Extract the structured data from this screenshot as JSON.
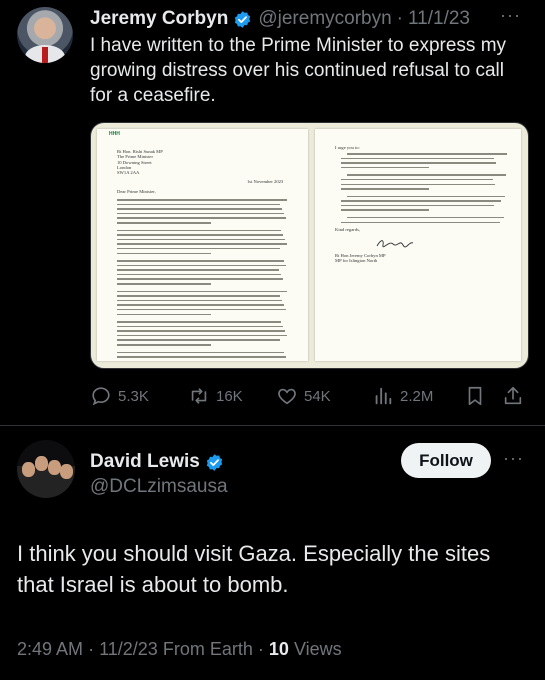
{
  "tweet": {
    "author_name": "Jeremy Corbyn",
    "handle": "@jeremycorbyn",
    "separator": "·",
    "date": "11/1/23",
    "text": "I have written to the Prime Minister to express my growing distress over his continued refusal to call for a ceasefire.",
    "letter_page1": {
      "monogram": "HHH",
      "address": [
        "Rt Hon. Rishi Sunak MP",
        "The Prime Minister",
        "10 Downing Street",
        "London",
        "SW1A 2AA"
      ],
      "date": "1st November 2023",
      "salutation": "Dear Prime Minister,"
    },
    "letter_page2": {
      "intro": "I urge you to:",
      "closing": "Kind regards,",
      "signoff": [
        "Rt Hon Jeremy Corbyn MP",
        "MP for Islington North"
      ]
    },
    "actions": {
      "replies": "5.3K",
      "reposts": "16K",
      "likes": "54K",
      "views": "2.2M"
    }
  },
  "reply": {
    "author_name": "David Lewis",
    "handle": "@DCLzimsausa",
    "follow_label": "Follow",
    "text": "I think you should visit Gaza. Especially the sites that Israel is about to bomb.",
    "meta_time": "2:49 AM",
    "meta_sep": "·",
    "meta_date": "11/2/23",
    "meta_source": "From Earth",
    "meta_views_count": "10",
    "meta_views_label": "Views"
  },
  "colors": {
    "background": "#000000",
    "text": "#e7e9ea",
    "muted": "#71767b",
    "verified": "#1d9bf0",
    "follow_bg": "#eff3f4"
  },
  "icons": [
    "verified-badge-icon",
    "more-icon",
    "reply-icon",
    "repost-icon",
    "like-icon",
    "views-icon",
    "bookmark-icon",
    "share-icon"
  ]
}
